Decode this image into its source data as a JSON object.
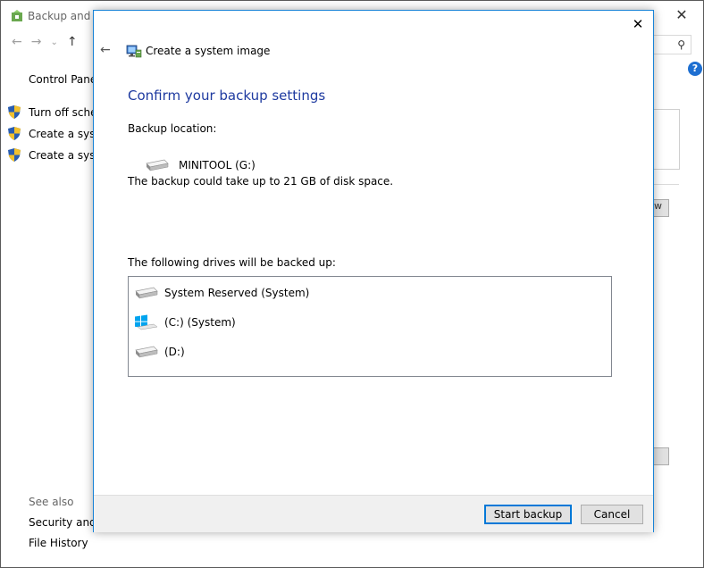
{
  "background": {
    "window_title": "Backup and R",
    "control_panel": "Control Panel",
    "links": [
      "Turn off sched",
      "Create a syste",
      "Create a syste"
    ],
    "see_also": "See also",
    "bottom_links": [
      "Security and M",
      "File History"
    ],
    "button_fragment": "w",
    "help": "?"
  },
  "dialog": {
    "title": "Create a system image",
    "heading": "Confirm your backup settings",
    "backup_location_label": "Backup location:",
    "location_drive": "MINITOOL (G:)",
    "space_note": "The backup could take up to 21 GB of disk space.",
    "drives_label": "The following drives will be backed up:",
    "drives": [
      {
        "name": "System Reserved (System)",
        "icon": "drive-icon"
      },
      {
        "name": "(C:) (System)",
        "icon": "windows-logo-icon"
      },
      {
        "name": "(D:)",
        "icon": "drive-icon"
      }
    ],
    "start_button": "Start backup",
    "cancel_button": "Cancel",
    "close": "✕",
    "back": "←"
  },
  "colors": {
    "accent": "#1883d7",
    "heading": "#1e3aa0",
    "windows_logo": "#00a4ef"
  }
}
